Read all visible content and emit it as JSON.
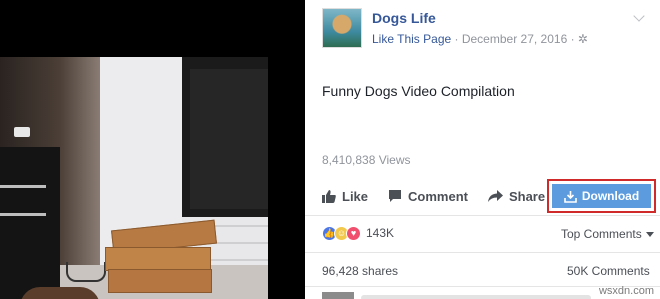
{
  "page": {
    "name": "Dogs Life",
    "like_page": "Like This Page",
    "separator": " · ",
    "date": "December 27, 2016",
    "gear_icon": "gear-icon"
  },
  "post": {
    "text": "Funny Dogs Video Compilation",
    "views": "8,410,838 Views"
  },
  "actions": {
    "like": "Like",
    "comment": "Comment",
    "share": "Share",
    "download": "Download"
  },
  "reactions": {
    "count": "143K",
    "types": [
      "like",
      "haha",
      "love"
    ],
    "top_comments": "Top Comments"
  },
  "stats": {
    "shares": "96,428 shares",
    "comments": "50K Comments"
  },
  "watermark": "wsxdn.com",
  "colors": {
    "link": "#365899",
    "download_bg": "#5b9bde",
    "highlight_border": "#d12a2a"
  }
}
